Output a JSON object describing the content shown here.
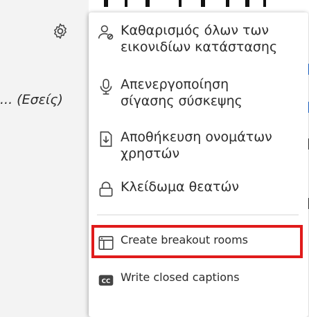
{
  "sidebar": {
    "user_label": "... (Εσείς)"
  },
  "menu": {
    "items": [
      {
        "label": "Καθαρισμός όλων των\nεικονιδίων κατάστασης",
        "icon": "clear-status-icon"
      },
      {
        "label": "Απενεργοποίηση\nσίγασης σύσκεψης",
        "icon": "microphone-icon"
      },
      {
        "label": "Αποθήκευση ονομάτων\nχρηστών",
        "icon": "save-file-icon"
      },
      {
        "label": "Κλείδωμα θεατών",
        "icon": "lock-icon"
      },
      {
        "label": "Create breakout rooms",
        "icon": "breakout-rooms-icon"
      },
      {
        "label": "Write closed captions",
        "icon": "closed-captions-icon"
      }
    ],
    "highlight_color": "#e01b1b"
  }
}
